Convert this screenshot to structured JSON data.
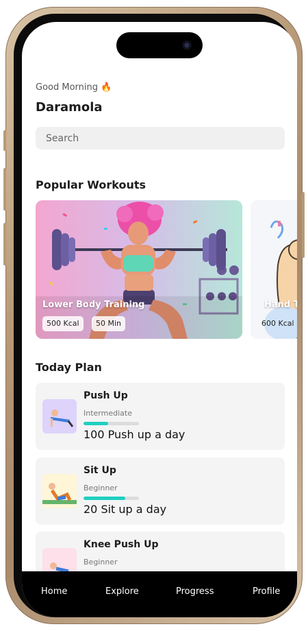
{
  "header": {
    "greeting": "Good Morning 🔥",
    "user_name": "Daramola"
  },
  "search": {
    "placeholder": "Search"
  },
  "popular": {
    "title": "Popular Workouts",
    "cards": [
      {
        "title": "Lower Body Training",
        "kcal": "500 Kcal",
        "duration": "50 Min"
      },
      {
        "title": "Hand Training",
        "kcal": "600 Kcal"
      }
    ]
  },
  "today": {
    "title": "Today Plan",
    "items": [
      {
        "title": "Push Up",
        "level": "Intermediate",
        "progress": 0.45,
        "desc": "100 Push up a day"
      },
      {
        "title": "Sit Up",
        "level": "Beginner",
        "progress": 0.75,
        "desc": "20 Sit up a day"
      },
      {
        "title": "Knee Push Up",
        "level": "Beginner"
      }
    ]
  },
  "tabs": [
    "Home",
    "Explore",
    "Progress",
    "Profile"
  ]
}
